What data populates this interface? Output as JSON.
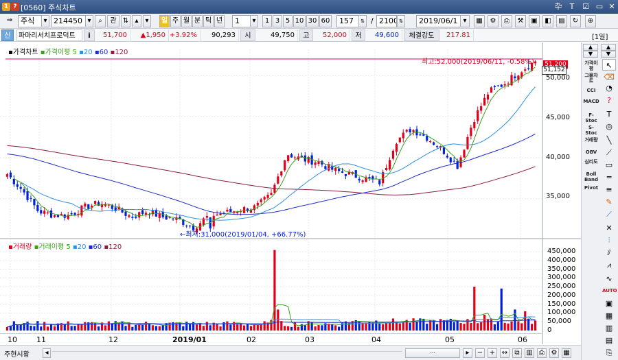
{
  "window": {
    "code_tag": "[0560]",
    "title": "주식차트",
    "icon1": "1",
    "icon2": "?",
    "controls": [
      "卆",
      "T",
      "☑",
      "▭",
      "✕"
    ]
  },
  "toolbar": {
    "market": "주식",
    "code": "214450",
    "related_label": "관",
    "day": "일",
    "period_tabs": [
      "주",
      "월",
      "분",
      "틱",
      "년"
    ],
    "unit_value": "1",
    "minute_presets": [
      "1",
      "3",
      "5",
      "10",
      "30",
      "60"
    ],
    "bars_shown": "157",
    "slash": "/",
    "bars_total": "2100",
    "date": "2019/06/1"
  },
  "info": {
    "badge": "신",
    "name": "파마리서치프로덕트",
    "i_label": "i",
    "price": "51,700",
    "change": "▲1,950",
    "change_pct": "+3.92%",
    "volume": "90,293",
    "open_label": "시",
    "open": "49,750",
    "high_label": "고",
    "high": "52,000",
    "low_label": "저",
    "low": "49,600",
    "strength_label": "체결강도",
    "strength": "217.81",
    "period_badge": "[1일]"
  },
  "price_panel": {
    "legend_title": "가격차트",
    "legend_ma": "가격이평",
    "legend_periods": [
      "5",
      "20",
      "60",
      "120"
    ],
    "current_box": "51,152",
    "high_box": "51,200",
    "high_note": "최고:52,000(2019/06/11, -0.58%)",
    "low_note": "←최저:31,000(2019/01/04, +66.77%)",
    "y_ticks": [
      "50,000",
      "45,000",
      "40,000",
      "35,000"
    ]
  },
  "volume_panel": {
    "legend_title": "거래량",
    "legend_ma": "거래이평",
    "legend_periods": [
      "5",
      "20",
      "60",
      "120"
    ],
    "y_ticks": [
      "450,000",
      "400,000",
      "350,000",
      "300,000",
      "250,000",
      "200,000",
      "150,000",
      "100,000",
      "50,000",
      "0"
    ]
  },
  "x_labels": [
    "10",
    "11",
    "12",
    "2019/01",
    "02",
    "03",
    "04",
    "05",
    "06"
  ],
  "right_indicators": [
    "가격이평",
    "그물차트",
    "CCI",
    "MACD",
    "F-Stoc",
    "S-Stoc",
    "거래량",
    "OBV",
    "심리도",
    "Boll Band",
    "Pivot"
  ],
  "bottom": {
    "tabs": [
      "주",
      "현",
      "시",
      "황"
    ]
  },
  "colors": {
    "up": "#e0001a",
    "down": "#0021d4",
    "ma5": "#3a9e1c",
    "ma20": "#2d8fe0",
    "ma60": "#1b2bc8",
    "ma120": "#8a1e3a",
    "high_line": "#e0006e"
  },
  "chart_data": {
    "type": "candlestick",
    "price": {
      "ylim": [
        30500,
        52500
      ],
      "high": 52000,
      "low": 31000,
      "close_last": 51700,
      "closes_anchor_by_month": {
        "10": [
          38000,
          36000,
          33500,
          33000
        ],
        "11": [
          33000,
          34000,
          34500,
          33800
        ],
        "12": [
          32800,
          33500,
          32800,
          32500
        ],
        "2019/01": [
          31500,
          33000,
          33300,
          33700
        ],
        "02": [
          34000,
          35500,
          40500,
          39800
        ],
        "03": [
          39500,
          38500,
          38000,
          37500
        ],
        "04": [
          37000,
          42000,
          43500,
          42500
        ],
        "05": [
          41000,
          39000,
          44500,
          48000
        ],
        "06": [
          49000,
          50500,
          51700
        ]
      }
    },
    "volume": {
      "ylim": [
        0,
        470000
      ],
      "peaks": [
        {
          "month": "02",
          "value": 460000
        },
        {
          "month": "05",
          "value": 250000
        },
        {
          "month": "06",
          "value": 240000
        }
      ]
    }
  }
}
